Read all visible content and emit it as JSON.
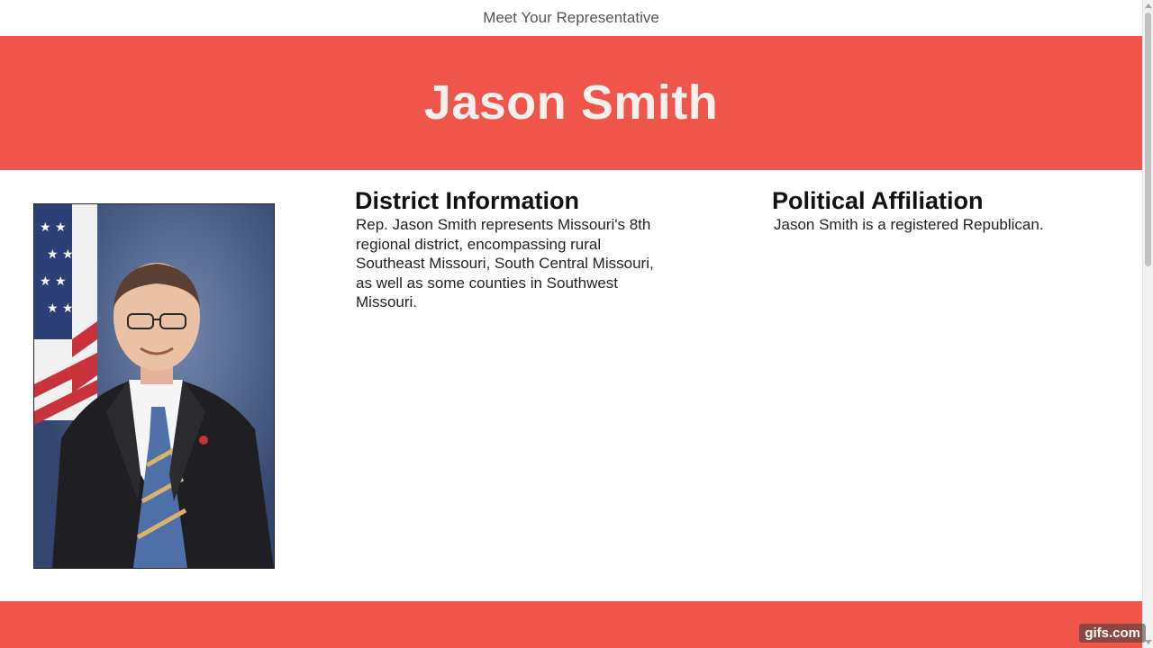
{
  "header": {
    "title": "Meet Your Representative"
  },
  "hero": {
    "name": "Jason Smith"
  },
  "district": {
    "heading": "District Information",
    "body": "Rep. Jason Smith represents Missouri's 8th regional district, encompassing rural Southeast Missouri, South Central Missouri, as well as some counties in Southwest Missouri."
  },
  "affiliation": {
    "heading": "Political Affiliation",
    "body": "Jason Smith is a registered Republican."
  },
  "watermark": "gifs.com",
  "colors": {
    "accent": "#ef554b",
    "hero_text": "#f5f0ee",
    "header_text": "#555555"
  }
}
